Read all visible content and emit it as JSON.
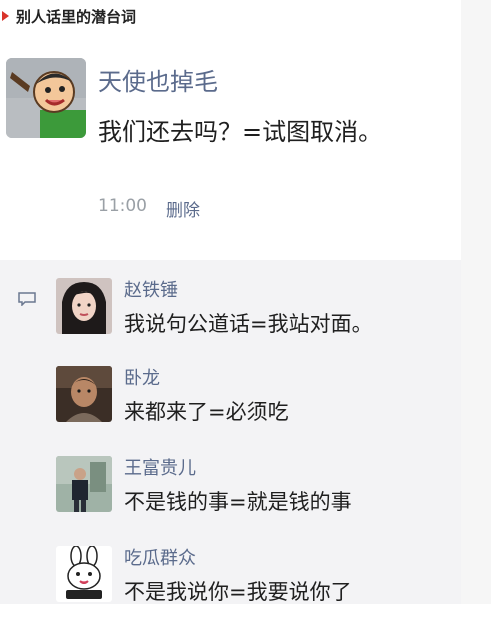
{
  "header": {
    "title": "别人话里的潜台词"
  },
  "post": {
    "author": "天使也掉毛",
    "content": "我们还去吗？=试图取消。",
    "time": "11:00",
    "delete_label": "删除",
    "avatar_icon": "cartoon-avatar"
  },
  "comments": [
    {
      "name": "赵铁锤",
      "text": "我说句公道话=我站对面。",
      "avatar_icon": "woman-photo-avatar"
    },
    {
      "name": "卧龙",
      "text": "来都来了=必须吃",
      "avatar_icon": "man-photo-avatar"
    },
    {
      "name": "王富贵儿",
      "text": "不是钱的事=就是钱的事",
      "avatar_icon": "standing-man-avatar"
    },
    {
      "name": "吃瓜群众",
      "text": "不是我说你=我要说你了",
      "avatar_icon": "rabbit-sticker-avatar"
    }
  ],
  "colors": {
    "name_link": "#5b6b8c",
    "marker_red": "#d9342b",
    "comment_bg": "#f3f3f5"
  }
}
